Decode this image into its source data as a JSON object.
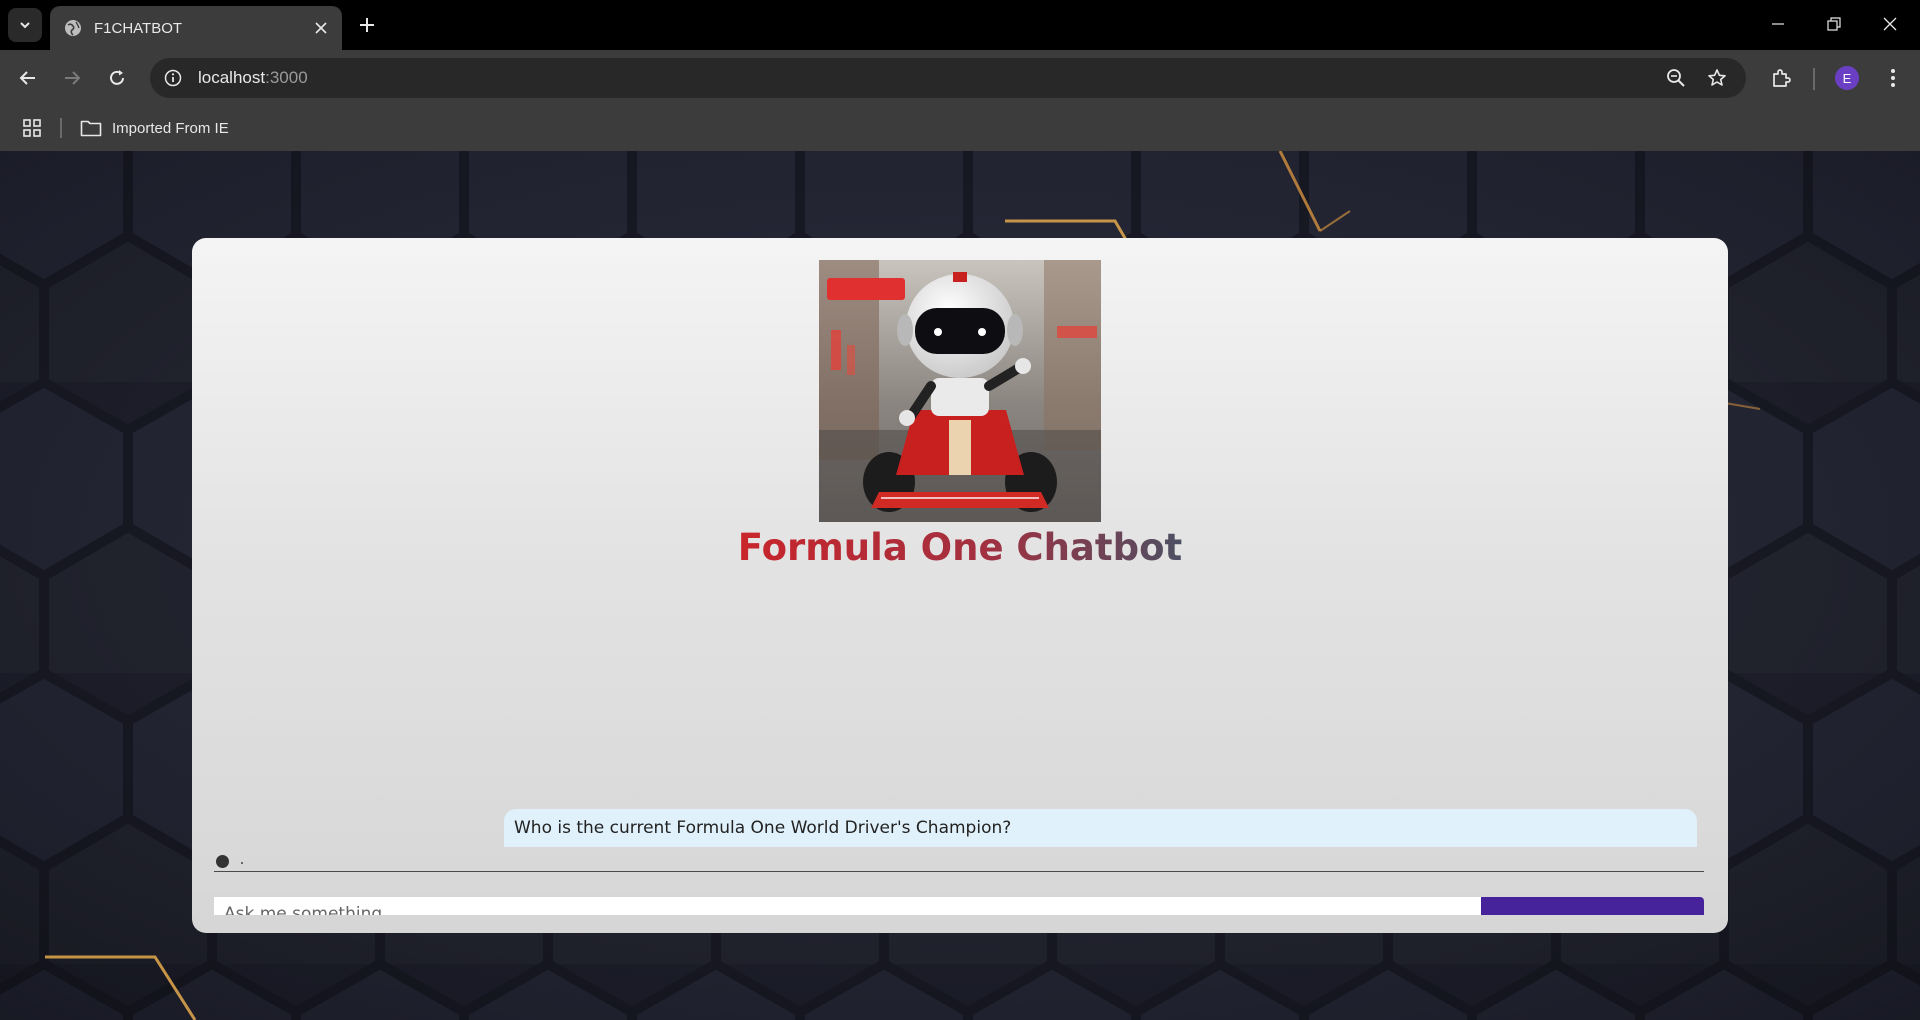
{
  "browser": {
    "tab_title": "F1CHATBOT",
    "url_host": "localhost",
    "url_port": ":3000",
    "profile_initial": "E",
    "bookmarks": [
      {
        "label": "Imported From IE"
      }
    ]
  },
  "page": {
    "title": "Formula One Chatbot",
    "messages": [
      {
        "role": "user",
        "text": "Who is the current Formula One World Driver's Champion?"
      }
    ],
    "input_placeholder": "Ask me something...",
    "send_label": ""
  },
  "colors": {
    "title_start": "#c9252b",
    "title_end": "#4d4f63",
    "user_bubble": "#e0f1fb",
    "send_button": "#46239a",
    "avatar": "#6a3fc4"
  }
}
